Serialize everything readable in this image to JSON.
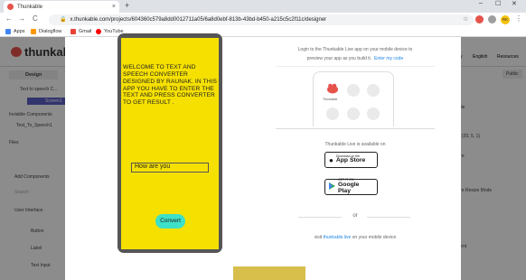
{
  "browser": {
    "tab_title": "Thunkable",
    "tab_close": "×",
    "new_tab": "+",
    "win_min": "–",
    "win_max": "☐",
    "win_close": "✕",
    "back": "←",
    "forward": "→",
    "reload": "C",
    "url": "x.thunkable.com/projects/604360c579a8dd0012711a05/6a8d0ebf-813b-43bd-b450-a215c5c2f11c/designer",
    "user_initials": "RK"
  },
  "bookmarks": [
    {
      "label": "Apps",
      "color": "#4285f4"
    },
    {
      "label": "Dialogflow",
      "color": "#ff9800"
    },
    {
      "label": "Gmail",
      "color": "#ea4335"
    },
    {
      "label": "YouTube",
      "color": "#ff0000"
    }
  ],
  "app": {
    "logo": "thunkable",
    "left_tab": "Design",
    "left_labels": {
      "screen_item": "Text to speech C...",
      "screen_btn": "Screen1",
      "invisible": "Invisible Components",
      "tts": "Text_To_Speech1",
      "files": "Files",
      "add": "Add Components",
      "search": "Search",
      "ui": "User Interface",
      "button": "Button",
      "label": "Label",
      "textinput": "Text Input"
    },
    "right_labels": {
      "community": "unity",
      "english": "English",
      "resources": "Resources",
      "public": "Public",
      "size": "(20, 5, 1)",
      "mode": "ture Resize Mode",
      "ture": "ture",
      "ment": "ment",
      "nple": "nple"
    }
  },
  "preview": {
    "welcome_text": "WELCOME TO TEXT AND SPEECH CONVERTER DESIGNED BY RAUNAK. IN THIS APP YOU HAVE TO ENTER THE TEXT AND PRESS CONVERTER  TO GET RESULT .",
    "input_value": "How are you",
    "button_label": "Convert"
  },
  "live": {
    "login_line1": "Login to the Thunkable Live app on your mobile device to",
    "login_line2": "preview your app as you build it.",
    "enter_code": "Enter my code",
    "app_label": "Thunkable",
    "available": "Thunkable Live is available on",
    "appstore_small": "Download on the",
    "appstore_big": "App Store",
    "play_small": "GET IT ON",
    "play_big": "Google Play",
    "or": "or",
    "visit_prefix": "visit ",
    "visit_link": "thunkable.live",
    "visit_suffix": " on your mobile device"
  },
  "colors": {
    "screen_bg": "#f5e000",
    "button_bg": "#3de0c8",
    "link": "#1e88e5",
    "brand": "#e5534b"
  }
}
